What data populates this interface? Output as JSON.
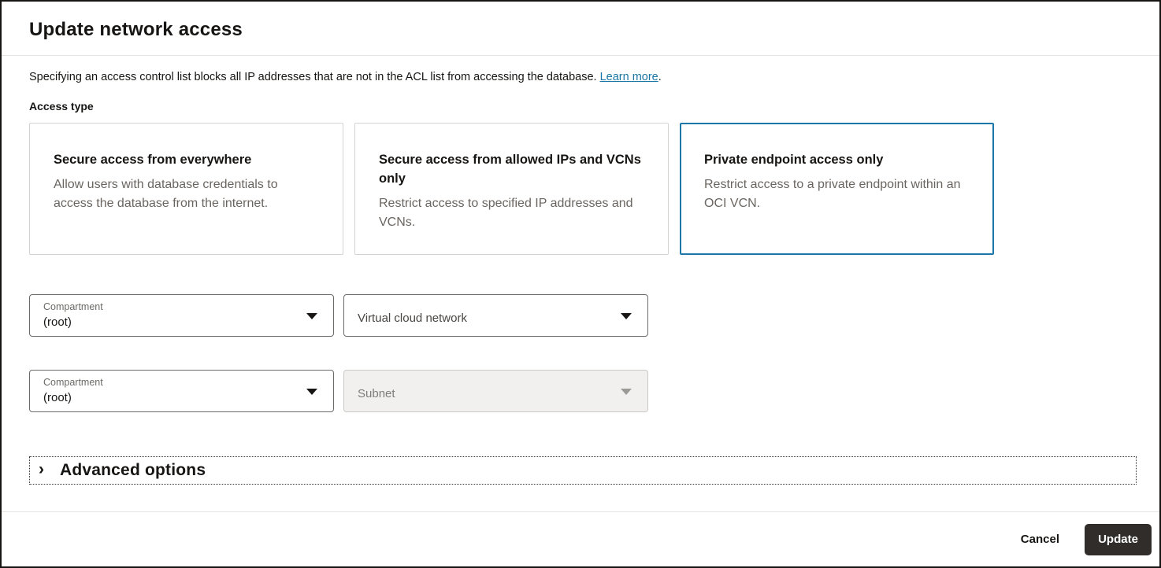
{
  "dialog": {
    "title": "Update network access",
    "description": "Specifying an access control list blocks all IP addresses that are not in the ACL list from accessing the database.",
    "learn_more_label": "Learn more",
    "period": "."
  },
  "access_type": {
    "label": "Access type",
    "options": [
      {
        "title": "Secure access from everywhere",
        "description": "Allow users with database credentials to access the database from the internet.",
        "selected": false
      },
      {
        "title": "Secure access from allowed IPs and VCNs only",
        "description": "Restrict access to specified IP addresses and VCNs.",
        "selected": false
      },
      {
        "title": "Private endpoint access only",
        "description": "Restrict access to a private endpoint within an OCI VCN.",
        "selected": true
      }
    ]
  },
  "form": {
    "vcn_compartment": {
      "label": "Compartment",
      "value": "(root)"
    },
    "vcn_select": {
      "placeholder": "Virtual cloud network"
    },
    "subnet_compartment": {
      "label": "Compartment",
      "value": "(root)"
    },
    "subnet_select": {
      "placeholder": "Subnet",
      "disabled": true
    }
  },
  "advanced_options": {
    "chevron": "›",
    "label": "Advanced options"
  },
  "footer": {
    "cancel_label": "Cancel",
    "update_label": "Update"
  },
  "colors": {
    "selected_card_border": "#1b77a9",
    "link": "#1a75a5",
    "primary_button_bg": "#312d2a",
    "disabled_bg": "#f1f0ee"
  }
}
